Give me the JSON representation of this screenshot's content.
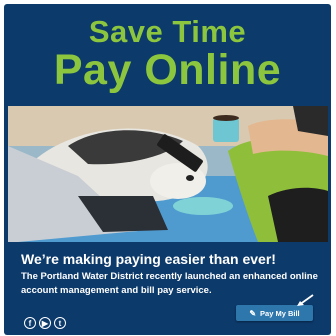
{
  "hero": {
    "title_line1": "Save Time",
    "title_line2": "Pay Online"
  },
  "content": {
    "headline": "We’re making paying easier than ever!",
    "body": "The Portland Water District recently launched an enhanced online account management and bill pay service."
  },
  "cta": {
    "label": "Pay My Bill",
    "icon": "wrench-icon"
  },
  "socials": [
    {
      "name": "facebook-icon",
      "glyph": "f"
    },
    {
      "name": "youtube-icon",
      "glyph": "▶"
    },
    {
      "name": "twitter-icon",
      "glyph": "t"
    }
  ],
  "colors": {
    "background": "#0c3a6b",
    "title_green": "#8cc63f",
    "button_blue": "#2e77ad",
    "text": "#ffffff"
  }
}
